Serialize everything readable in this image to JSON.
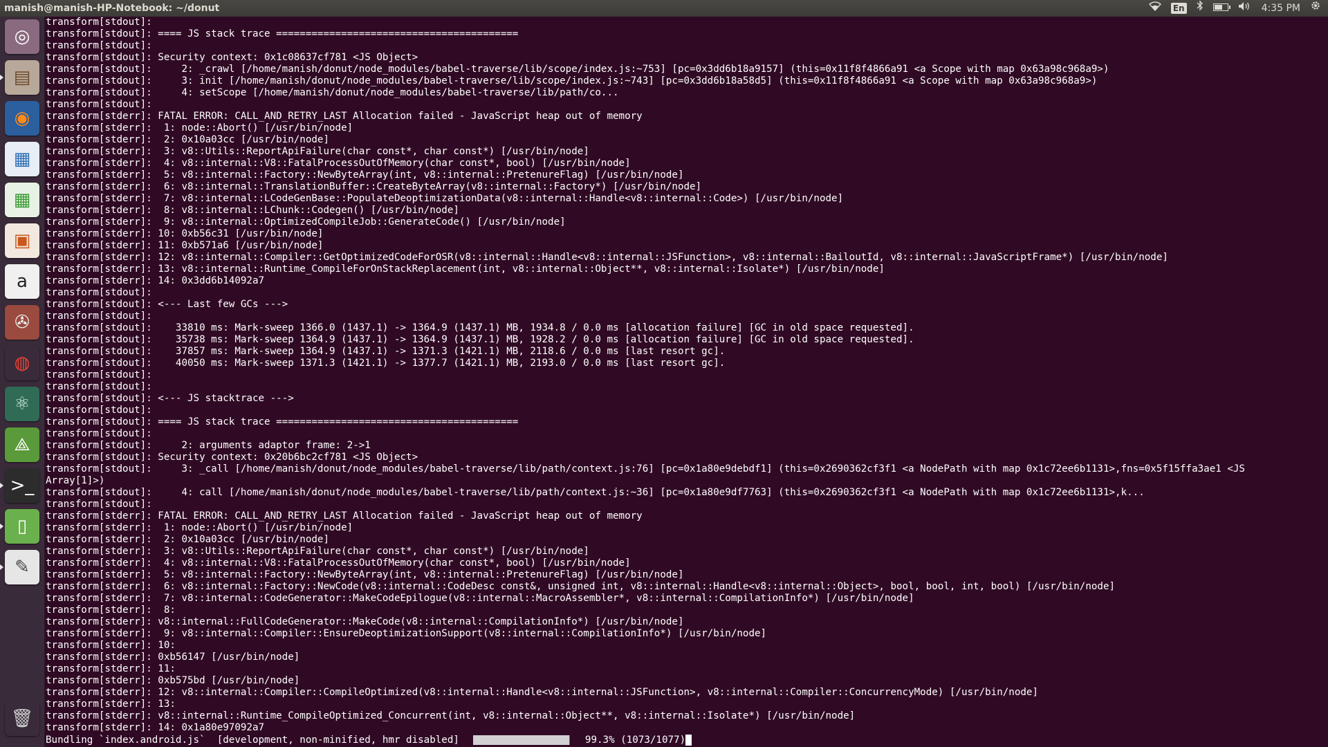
{
  "window": {
    "title": "manish@manish-HP-Notebook: ~/donut"
  },
  "panel": {
    "keyboard_layout": "En",
    "clock": "4:35 PM",
    "icons": [
      "wifi-icon",
      "keyboard-layout-indicator",
      "bluetooth-icon",
      "battery-icon",
      "volume-icon",
      "settings-gear-icon"
    ]
  },
  "launcher": {
    "items": [
      {
        "name": "dash-home",
        "icon": "ubuntu-logo-icon",
        "glyph": "◎",
        "bg": "#8a6a7f",
        "fg": "#ffffff"
      },
      {
        "name": "files",
        "icon": "file-cabinet-icon",
        "glyph": "▤",
        "bg": "#b8a89a",
        "fg": "#6b4a2a"
      },
      {
        "name": "firefox",
        "icon": "firefox-icon",
        "glyph": "◉",
        "bg": "#2b5f9e",
        "fg": "#ff8a1c"
      },
      {
        "name": "libreoffice-writer",
        "icon": "document-icon",
        "glyph": "▦",
        "bg": "#e8eef5",
        "fg": "#2f6fb5"
      },
      {
        "name": "libreoffice-calc",
        "icon": "spreadsheet-icon",
        "glyph": "▦",
        "bg": "#e8f2e4",
        "fg": "#3b9a35"
      },
      {
        "name": "libreoffice-impress",
        "icon": "presentation-icon",
        "glyph": "▣",
        "bg": "#f3e8df",
        "fg": "#c8581d"
      },
      {
        "name": "amazon",
        "icon": "amazon-icon",
        "glyph": "a",
        "bg": "#f0f0f0",
        "fg": "#222222"
      },
      {
        "name": "system-settings",
        "icon": "wrench-gear-icon",
        "glyph": "✇",
        "bg": "#9a4a3e",
        "fg": "#eeeeee"
      },
      {
        "name": "chrome",
        "icon": "chrome-icon",
        "glyph": "◍",
        "bg": "#3a2b3a",
        "fg": "#e94235"
      },
      {
        "name": "atom",
        "icon": "atom-icon",
        "glyph": "⚛",
        "bg": "#2f6b55",
        "fg": "#cfeee0"
      },
      {
        "name": "android-studio",
        "icon": "android-studio-icon",
        "glyph": "⟁",
        "bg": "#5a9a3a",
        "fg": "#ffffff"
      },
      {
        "name": "terminal",
        "icon": "terminal-icon",
        "glyph": ">_",
        "bg": "#2c2c2c",
        "fg": "#ffffff"
      },
      {
        "name": "android-emulator",
        "icon": "phone-icon",
        "glyph": "▯",
        "bg": "#6ab04c",
        "fg": "#ffffff"
      },
      {
        "name": "text-editor",
        "icon": "text-editor-icon",
        "glyph": "✎",
        "bg": "#e6e6e6",
        "fg": "#444444"
      },
      {
        "name": "trash",
        "icon": "trash-icon",
        "glyph": "🗑",
        "bg": "#3a2b3a",
        "fg": "#cfcfcf"
      }
    ]
  },
  "terminal": {
    "lines": [
      "transform[stdout]:",
      "transform[stdout]: ==== JS stack trace =========================================",
      "transform[stdout]:",
      "transform[stdout]: Security context: 0x1c08637cf781 <JS Object>",
      "transform[stdout]:     2: _crawl [/home/manish/donut/node_modules/babel-traverse/lib/scope/index.js:~753] [pc=0x3dd6b18a9157] (this=0x11f8f4866a91 <a Scope with map 0x63a98c968a9>)",
      "transform[stdout]:     3: init [/home/manish/donut/node_modules/babel-traverse/lib/scope/index.js:~743] [pc=0x3dd6b18a58d5] (this=0x11f8f4866a91 <a Scope with map 0x63a98c968a9>)",
      "transform[stdout]:     4: setScope [/home/manish/donut/node_modules/babel-traverse/lib/path/co...",
      "transform[stdout]:",
      "transform[stderr]: FATAL ERROR: CALL_AND_RETRY_LAST Allocation failed - JavaScript heap out of memory",
      "transform[stderr]:  1: node::Abort() [/usr/bin/node]",
      "transform[stderr]:  2: 0x10a03cc [/usr/bin/node]",
      "transform[stderr]:  3: v8::Utils::ReportApiFailure(char const*, char const*) [/usr/bin/node]",
      "transform[stderr]:  4: v8::internal::V8::FatalProcessOutOfMemory(char const*, bool) [/usr/bin/node]",
      "transform[stderr]:  5: v8::internal::Factory::NewByteArray(int, v8::internal::PretenureFlag) [/usr/bin/node]",
      "transform[stderr]:  6: v8::internal::TranslationBuffer::CreateByteArray(v8::internal::Factory*) [/usr/bin/node]",
      "transform[stderr]:  7: v8::internal::LCodeGenBase::PopulateDeoptimizationData(v8::internal::Handle<v8::internal::Code>) [/usr/bin/node]",
      "transform[stderr]:  8: v8::internal::LChunk::Codegen() [/usr/bin/node]",
      "transform[stderr]:  9: v8::internal::OptimizedCompileJob::GenerateCode() [/usr/bin/node]",
      "transform[stderr]: 10: 0xb56c31 [/usr/bin/node]",
      "transform[stderr]: 11: 0xb571a6 [/usr/bin/node]",
      "transform[stderr]: 12: v8::internal::Compiler::GetOptimizedCodeForOSR(v8::internal::Handle<v8::internal::JSFunction>, v8::internal::BailoutId, v8::internal::JavaScriptFrame*) [/usr/bin/node]",
      "transform[stderr]: 13: v8::internal::Runtime_CompileForOnStackReplacement(int, v8::internal::Object**, v8::internal::Isolate*) [/usr/bin/node]",
      "transform[stderr]: 14: 0x3dd6b14092a7",
      "transform[stdout]:",
      "transform[stdout]: <--- Last few GCs --->",
      "transform[stdout]:",
      "transform[stdout]:    33810 ms: Mark-sweep 1366.0 (1437.1) -> 1364.9 (1437.1) MB, 1934.8 / 0.0 ms [allocation failure] [GC in old space requested].",
      "transform[stdout]:    35738 ms: Mark-sweep 1364.9 (1437.1) -> 1364.9 (1437.1) MB, 1928.2 / 0.0 ms [allocation failure] [GC in old space requested].",
      "transform[stdout]:    37857 ms: Mark-sweep 1364.9 (1437.1) -> 1371.3 (1421.1) MB, 2118.6 / 0.0 ms [last resort gc].",
      "transform[stdout]:    40050 ms: Mark-sweep 1371.3 (1421.1) -> 1377.7 (1421.1) MB, 2193.0 / 0.0 ms [last resort gc].",
      "transform[stdout]:",
      "transform[stdout]:",
      "transform[stdout]: <--- JS stacktrace --->",
      "transform[stdout]:",
      "transform[stdout]: ==== JS stack trace =========================================",
      "transform[stdout]:",
      "transform[stdout]:     2: arguments adaptor frame: 2->1",
      "transform[stdout]: Security context: 0x20b6bc2cf781 <JS Object>",
      "transform[stdout]:     3: _call [/home/manish/donut/node_modules/babel-traverse/lib/path/context.js:76] [pc=0x1a80e9debdf1] (this=0x2690362cf3f1 <a NodePath with map 0x1c72ee6b1131>,fns=0x5f15ffa3ae1 <JS",
      "Array[1]>)",
      "transform[stdout]:     4: call [/home/manish/donut/node_modules/babel-traverse/lib/path/context.js:~36] [pc=0x1a80e9df7763] (this=0x2690362cf3f1 <a NodePath with map 0x1c72ee6b1131>,k...",
      "transform[stdout]:",
      "transform[stderr]: FATAL ERROR: CALL_AND_RETRY_LAST Allocation failed - JavaScript heap out of memory",
      "transform[stderr]:  1: node::Abort() [/usr/bin/node]",
      "transform[stderr]:  2: 0x10a03cc [/usr/bin/node]",
      "transform[stderr]:  3: v8::Utils::ReportApiFailure(char const*, char const*) [/usr/bin/node]",
      "transform[stderr]:  4: v8::internal::V8::FatalProcessOutOfMemory(char const*, bool) [/usr/bin/node]",
      "transform[stderr]:  5: v8::internal::Factory::NewByteArray(int, v8::internal::PretenureFlag) [/usr/bin/node]",
      "transform[stderr]:  6: v8::internal::Factory::NewCode(v8::internal::CodeDesc const&, unsigned int, v8::internal::Handle<v8::internal::Object>, bool, bool, int, bool) [/usr/bin/node]",
      "transform[stderr]:  7: v8::internal::CodeGenerator::MakeCodeEpilogue(v8::internal::MacroAssembler*, v8::internal::CompilationInfo*) [/usr/bin/node]",
      "transform[stderr]:  8:",
      "transform[stderr]: v8::internal::FullCodeGenerator::MakeCode(v8::internal::CompilationInfo*) [/usr/bin/node]",
      "transform[stderr]:  9: v8::internal::Compiler::EnsureDeoptimizationSupport(v8::internal::CompilationInfo*) [/usr/bin/node]",
      "transform[stderr]: 10:",
      "transform[stderr]: 0xb56147 [/usr/bin/node]",
      "transform[stderr]: 11:",
      "transform[stderr]: 0xb575bd [/usr/bin/node]",
      "transform[stderr]: 12: v8::internal::Compiler::CompileOptimized(v8::internal::Handle<v8::internal::JSFunction>, v8::internal::Compiler::ConcurrencyMode) [/usr/bin/node]",
      "transform[stderr]: 13:",
      "transform[stderr]: v8::internal::Runtime_CompileOptimized_Concurrent(int, v8::internal::Object**, v8::internal::Isolate*) [/usr/bin/node]",
      "transform[stderr]: 14: 0x1a80e97092a7"
    ],
    "bundle": {
      "label": "Bundling `index.android.js`  [development, non-minified, hmr disabled]",
      "progress_percent": 99.3,
      "progress_text": "99.3% (1073/1077)"
    },
    "colors": {
      "background": "#300a24",
      "foreground": "#ffffff"
    }
  }
}
